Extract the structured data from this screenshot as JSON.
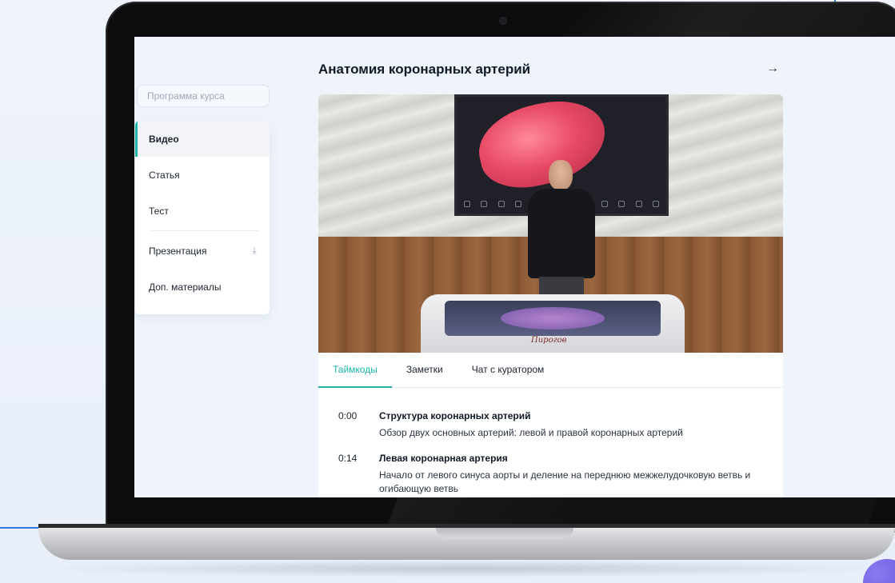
{
  "lesson": {
    "title": "Анатомия коронарных артерий",
    "next_icon": "arrow-right-icon"
  },
  "sidebar": {
    "search_placeholder": "Программа курса",
    "items": [
      {
        "label": "Видео",
        "active": true
      },
      {
        "label": "Статья",
        "active": false
      },
      {
        "label": "Тест",
        "active": false
      },
      {
        "label": "Презентация",
        "active": false,
        "icon": "download-icon"
      },
      {
        "label": "Доп. материалы",
        "active": false
      }
    ]
  },
  "video": {
    "signature": "Пирогов"
  },
  "tabs": [
    {
      "label": "Таймкоды",
      "active": true
    },
    {
      "label": "Заметки",
      "active": false
    },
    {
      "label": "Чат с куратором",
      "active": false
    }
  ],
  "timecodes": [
    {
      "time": "0:00",
      "title": "Структура коронарных артерий",
      "description": "Обзор двух основных артерий: левой и правой коронарных артерий"
    },
    {
      "time": "0:14",
      "title": "Левая коронарная артерия",
      "description": "Начало от левого синуса аорты и деление на переднюю межжелудочковую ветвь и огибающую ветвь"
    }
  ],
  "colors": {
    "accent": "#1bb6a6",
    "frame_accent": "#2a7de1"
  }
}
